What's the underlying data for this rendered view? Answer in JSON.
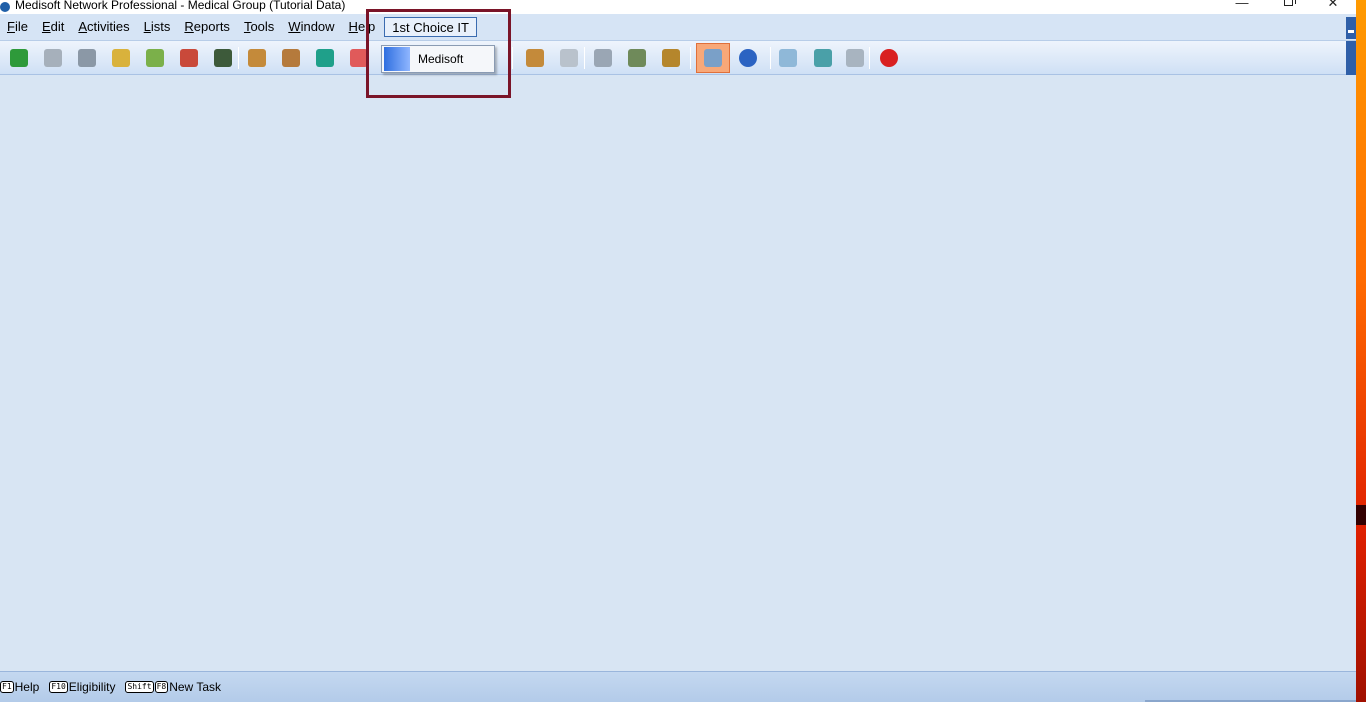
{
  "window": {
    "title": "Medisoft Network Professional - Medical Group (Tutorial Data)",
    "controls": {
      "minimize": "—",
      "close": "✕"
    }
  },
  "menubar": {
    "items": [
      {
        "label": "File",
        "accel": "F",
        "rest": "ile"
      },
      {
        "label": "Edit",
        "accel": "E",
        "rest": "dit"
      },
      {
        "label": "Activities",
        "accel": "A",
        "rest": "ctivities"
      },
      {
        "label": "Lists",
        "accel": "L",
        "rest": "ists"
      },
      {
        "label": "Reports",
        "accel": "R",
        "rest": "eports"
      },
      {
        "label": "Tools",
        "accel": "T",
        "rest": "ools"
      },
      {
        "label": "Window",
        "accel": "W",
        "rest": "indow"
      },
      {
        "label": "Help",
        "accel": "H",
        "rest": "elp"
      },
      {
        "label": "1st Choice IT"
      }
    ]
  },
  "dropdown": {
    "items": [
      {
        "label": "Medisoft"
      }
    ]
  },
  "toolbar": {
    "buttons": [
      {
        "name": "transaction-entry-icon",
        "color": "#2e9a3a"
      },
      {
        "name": "claim-management-icon",
        "color": "#a6b0bb"
      },
      {
        "name": "collection-list-icon",
        "color": "#8b98a6"
      },
      {
        "name": "deposit-list-icon",
        "color": "#d9b23c"
      },
      {
        "name": "statement-management-icon",
        "color": "#7bb04a"
      },
      {
        "name": "appointment-book-icon",
        "color": "#c9493a"
      },
      {
        "name": "office-hours-icon",
        "color": "#3d5a3a"
      },
      {
        "name": "patient-list-icon",
        "color": "#c48a3a"
      },
      {
        "name": "insurance-carrier-list-icon",
        "color": "#b57a3c"
      },
      {
        "name": "address-list-icon",
        "color": "#1fa08a"
      },
      {
        "name": "procedure-codes-icon",
        "color": "#e05a5a"
      },
      {
        "name": "provider-list-icon",
        "color": "#c48a3a"
      },
      {
        "name": "referring-provider-icon",
        "color": "#b9c2cc"
      },
      {
        "name": "quick-ledger-icon",
        "color": "#9aa6b4"
      },
      {
        "name": "quick-balance-icon",
        "color": "#6f8a5a"
      },
      {
        "name": "final-draft-icon",
        "color": "#b5862c"
      },
      {
        "name": "show-hide-hints-icon",
        "color": "#7aa0c8"
      },
      {
        "name": "help-icon",
        "color": "#2b63c2"
      },
      {
        "name": "user-manual-icon",
        "color": "#8fb8d8"
      },
      {
        "name": "backup-icon",
        "color": "#4aa0a8"
      },
      {
        "name": "restore-icon",
        "color": "#a8b4c0"
      },
      {
        "name": "exit-icon",
        "color": "#d92020"
      }
    ]
  },
  "statusbar": {
    "items": [
      {
        "keys": [
          "F1"
        ],
        "label": "Help"
      },
      {
        "keys": [
          "F10"
        ],
        "label": "Eligibility"
      },
      {
        "keys": [
          "Shift",
          "F8"
        ],
        "label": "New Task"
      }
    ]
  },
  "colors": {
    "client_bg": "#d8e5f3",
    "annotation": "#7a1428",
    "menubar_bg": "#d6e4f5"
  }
}
